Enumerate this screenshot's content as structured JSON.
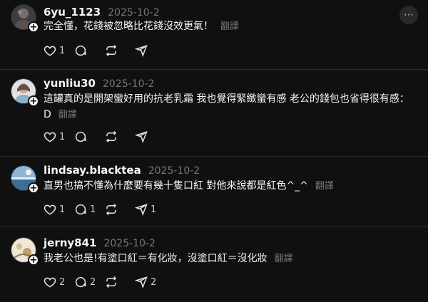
{
  "comments": [
    {
      "username": "6yu_1123",
      "date": "2025-10-2",
      "text": "完全懂，花錢被忽略比花錢沒效更氣！",
      "translate_label": "翻譯",
      "likes": "1",
      "replies": "",
      "reposts": "",
      "shares": ""
    },
    {
      "username": "yunliu30",
      "date": "2025-10-2",
      "text": "這罐真的是開架蠻好用的抗老乳霜 我也覺得緊緻蠻有感 老公的錢包也省得很有感：D",
      "translate_label": "翻譯",
      "likes": "1",
      "replies": "",
      "reposts": "",
      "shares": ""
    },
    {
      "username": "lindsay.blacktea",
      "date": "2025-10-2",
      "text": "直男也搞不懂為什麼要有幾十隻口紅 對他來說都是紅色^_^",
      "translate_label": "翻譯",
      "likes": "1",
      "replies": "1",
      "reposts": "",
      "shares": "1"
    },
    {
      "username": "jerny841",
      "date": "2025-10-2",
      "text": "我老公也是!有塗口紅＝有化妝，沒塗口紅＝沒化妝",
      "translate_label": "翻譯",
      "likes": "2",
      "replies": "2",
      "reposts": "",
      "shares": "2"
    }
  ],
  "icons": {
    "like": "heart-icon",
    "reply": "comment-icon",
    "repost": "repost-icon",
    "share": "share-icon",
    "follow": "plus-icon",
    "more": "more-icon"
  },
  "colors": {
    "background": "#101010",
    "text": "#f3f5f7",
    "muted": "#777777",
    "divider": "#2d2d2d"
  }
}
